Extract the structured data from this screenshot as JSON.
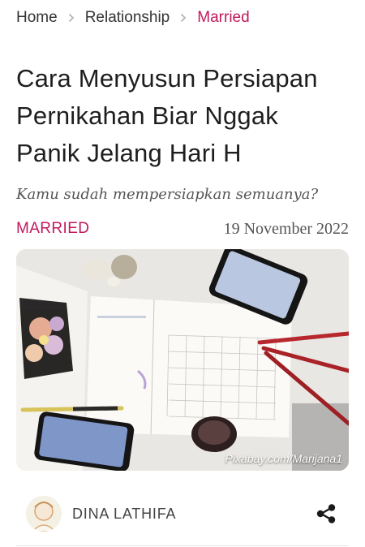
{
  "breadcrumb": {
    "home": "Home",
    "section": "Relationship",
    "current": "Married"
  },
  "article": {
    "title_lines": [
      "Cara Menyusun Persiapan",
      "Pernikahan Biar Nggak",
      "Panik Jelang Hari H"
    ],
    "subtitle": "Kamu sudah mempersiapkan semuanya?",
    "category": "MARRIED",
    "date": "19 November 2022",
    "image_credit": "Pixabay.com/Marijana1"
  },
  "author": {
    "name": "DINA LATHIFA"
  },
  "icons": {
    "breadcrumb_separator": "chevron-right-icon",
    "share": "share-icon"
  },
  "colors": {
    "accent": "#c2185b",
    "text": "#1e1e1e"
  }
}
